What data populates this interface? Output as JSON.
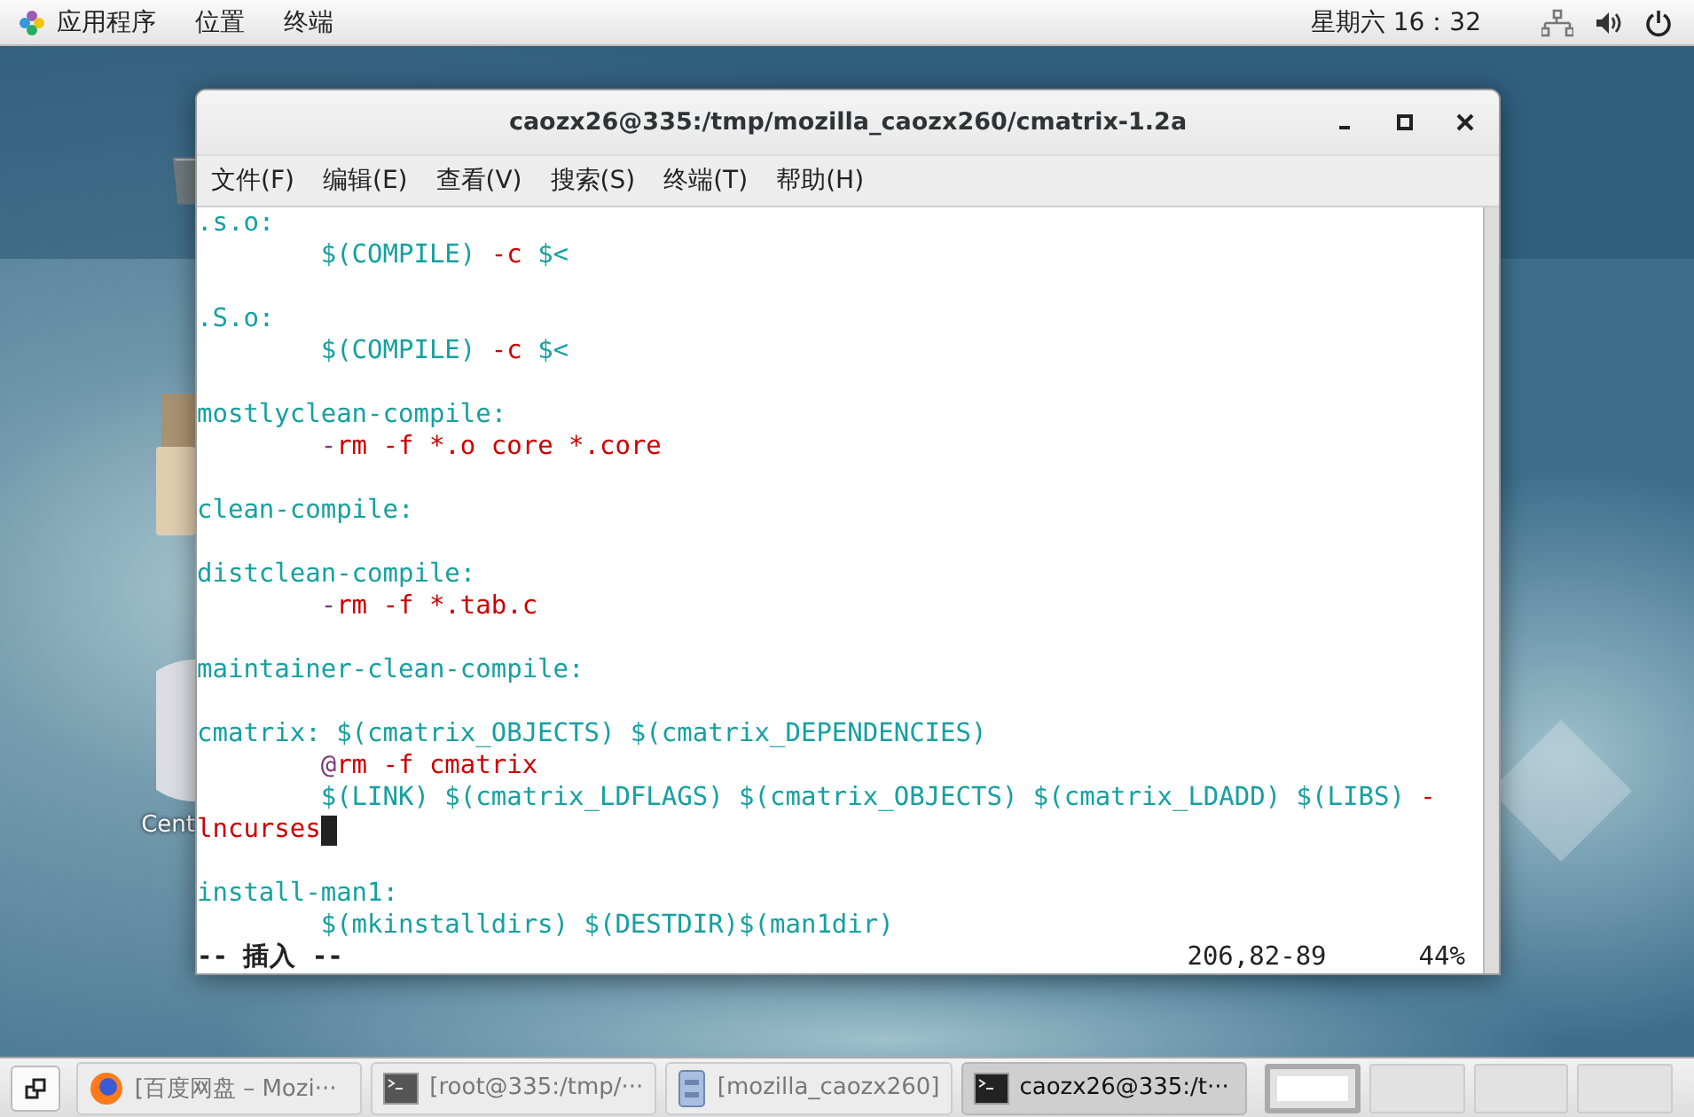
{
  "top_bar": {
    "menus": [
      "应用程序",
      "位置",
      "终端"
    ],
    "clock": "星期六 16：32"
  },
  "desktop": {
    "icons": [
      {
        "kind": "trash"
      },
      {
        "kind": "package"
      },
      {
        "kind": "disc",
        "label": "Cent"
      }
    ]
  },
  "window": {
    "title": "caozx26@335:/tmp/mozilla_caozx260/cmatrix-1.2a",
    "menu": [
      "文件(F)",
      "编辑(E)",
      "查看(V)",
      "搜索(S)",
      "终端(T)",
      "帮助(H)"
    ],
    "lines": [
      {
        "kind": "code",
        "segments": [
          {
            "text": ".s.o:",
            "color": "#16a0a0"
          }
        ]
      },
      {
        "kind": "code",
        "segments": [
          {
            "text": "        $(COMPILE) ",
            "color": "#16a0a0"
          },
          {
            "text": "-c",
            "color": "#cc0000"
          },
          {
            "text": " $<",
            "color": "#16a0a0"
          }
        ]
      },
      {
        "kind": "blank"
      },
      {
        "kind": "code",
        "segments": [
          {
            "text": ".S.o:",
            "color": "#16a0a0"
          }
        ]
      },
      {
        "kind": "code",
        "segments": [
          {
            "text": "        $(COMPILE) ",
            "color": "#16a0a0"
          },
          {
            "text": "-c",
            "color": "#cc0000"
          },
          {
            "text": " $<",
            "color": "#16a0a0"
          }
        ]
      },
      {
        "kind": "blank"
      },
      {
        "kind": "code",
        "segments": [
          {
            "text": "mostlyclean-compile:",
            "color": "#16a0a0"
          }
        ]
      },
      {
        "kind": "code",
        "segments": [
          {
            "text": "        -",
            "color": "#7a3a7a"
          },
          {
            "text": "rm -f *.o core *.core",
            "color": "#cc0000"
          }
        ]
      },
      {
        "kind": "blank"
      },
      {
        "kind": "code",
        "segments": [
          {
            "text": "clean-compile:",
            "color": "#16a0a0"
          }
        ]
      },
      {
        "kind": "blank"
      },
      {
        "kind": "code",
        "segments": [
          {
            "text": "distclean-compile:",
            "color": "#16a0a0"
          }
        ]
      },
      {
        "kind": "code",
        "segments": [
          {
            "text": "        -",
            "color": "#7a3a7a"
          },
          {
            "text": "rm -f *.tab.c",
            "color": "#cc0000"
          }
        ]
      },
      {
        "kind": "blank"
      },
      {
        "kind": "code",
        "segments": [
          {
            "text": "maintainer-clean-compile:",
            "color": "#16a0a0"
          }
        ]
      },
      {
        "kind": "blank"
      },
      {
        "kind": "code",
        "segments": [
          {
            "text": "cmatrix: $(cmatrix_OBJECTS) $(cmatrix_DEPENDENCIES)",
            "color": "#16a0a0"
          }
        ]
      },
      {
        "kind": "code",
        "segments": [
          {
            "text": "        @",
            "color": "#7a3a7a"
          },
          {
            "text": "rm -f cmatrix",
            "color": "#cc0000"
          }
        ]
      },
      {
        "kind": "code",
        "segments": [
          {
            "text": "        $(LINK) $(cmatrix_LDFLAGS) $(cmatrix_OBJECTS) $(cmatrix_LDADD) $(LIBS) ",
            "color": "#16a0a0"
          },
          {
            "text": "-",
            "color": "#cc0000"
          }
        ]
      },
      {
        "kind": "code",
        "cursor": true,
        "segments": [
          {
            "text": "lncurses",
            "color": "#cc0000"
          }
        ]
      },
      {
        "kind": "blank"
      },
      {
        "kind": "code",
        "segments": [
          {
            "text": "install-man1:",
            "color": "#16a0a0"
          }
        ]
      },
      {
        "kind": "code",
        "segments": [
          {
            "text": "        $(mkinstalldirs) $(DESTDIR)$(man1dir)",
            "color": "#16a0a0"
          }
        ]
      }
    ],
    "status": {
      "mode": "-- 插入 --",
      "position": "206,82-89",
      "percent": "44%"
    }
  },
  "taskbar": {
    "windows": [
      {
        "kind": "browser",
        "label": "[百度网盘 – Mozi···",
        "selected": false
      },
      {
        "kind": "terminal",
        "label": "[root@335:/tmp/···",
        "selected": false
      },
      {
        "kind": "files",
        "label": "[mozilla_caozx260]",
        "selected": false
      },
      {
        "kind": "terminal",
        "label": "caozx26@335:/t···",
        "selected": true
      }
    ],
    "workspaces": [
      {
        "selected": true
      },
      {
        "selected": false
      },
      {
        "selected": false
      },
      {
        "selected": false
      }
    ]
  }
}
